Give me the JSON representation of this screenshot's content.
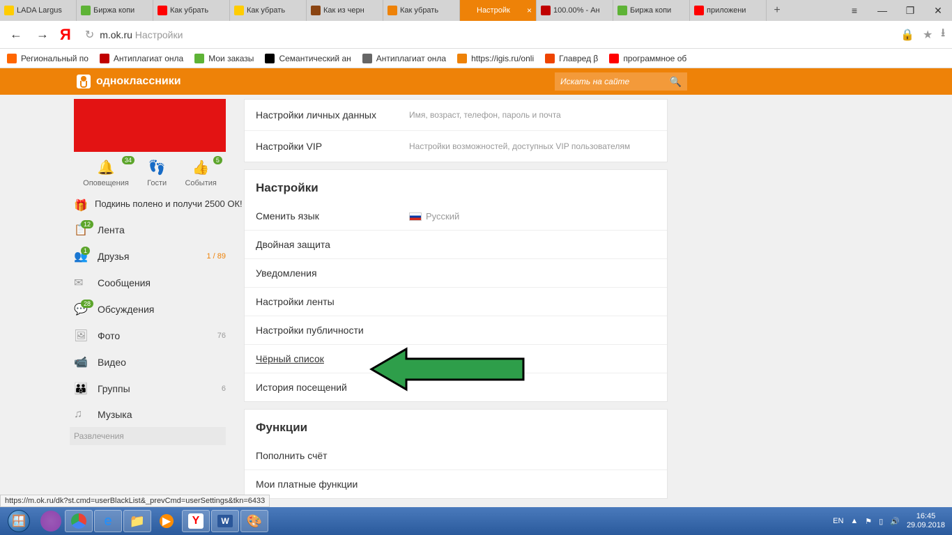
{
  "browser": {
    "tabs": [
      {
        "ico": "#ffcc00",
        "label": "LADA Largus"
      },
      {
        "ico": "#5eb336",
        "label": "Биржа копи"
      },
      {
        "ico": "#ff0000",
        "label": "Как убрать"
      },
      {
        "ico": "#ffcc00",
        "label": "Как убрать"
      },
      {
        "ico": "#8b4513",
        "label": "Как из черн"
      },
      {
        "ico": "#ee8208",
        "label": "Как убрать"
      },
      {
        "ico": "#ee8208",
        "label": "Настройк",
        "active": true
      },
      {
        "ico": "#c00000",
        "label": "100.00% - Ан"
      },
      {
        "ico": "#5eb336",
        "label": "Биржа копи"
      },
      {
        "ico": "#ff0000",
        "label": "приложени"
      }
    ],
    "url_prefix": "m.ok.ru",
    "url_rest": " Настройки",
    "bookmarks": [
      {
        "ico": "#ff6600",
        "label": "Региональный по"
      },
      {
        "ico": "#c00000",
        "label": "Антиплагиат онла"
      },
      {
        "ico": "#5eb336",
        "label": "Мои заказы"
      },
      {
        "ico": "#000000",
        "label": "Семантический ан"
      },
      {
        "ico": "#666666",
        "label": "Антиплагиат онла"
      },
      {
        "ico": "#ee8208",
        "label": "https://igis.ru/onli"
      },
      {
        "ico": "#ee4400",
        "label": "Главред β"
      },
      {
        "ico": "#ff0000",
        "label": "программное об"
      }
    ]
  },
  "ok": {
    "brand": "одноклассники",
    "search_placeholder": "Искать на сайте",
    "profile_actions": [
      {
        "icon": "🔔",
        "badge": "34",
        "label": "Оповещения"
      },
      {
        "icon": "👣",
        "badge": "",
        "label": "Гости"
      },
      {
        "icon": "👍",
        "badge": "5",
        "label": "События"
      }
    ],
    "promo": {
      "icon": "🎁",
      "text": "Подкинь полено и получи 2500 ОК!"
    },
    "sidebar": [
      {
        "icon": "📋",
        "badge": "12",
        "label": "Лента",
        "count": ""
      },
      {
        "icon": "👥",
        "badge": "1",
        "label": "Друзья",
        "count": "1 / 89",
        "orange": true
      },
      {
        "icon": "✉",
        "badge": "",
        "label": "Сообщения",
        "count": ""
      },
      {
        "icon": "💬",
        "badge": "28",
        "label": "Обсуждения",
        "count": ""
      },
      {
        "icon": "🖼",
        "badge": "",
        "label": "Фото",
        "count": "76"
      },
      {
        "icon": "📹",
        "badge": "",
        "label": "Видео",
        "count": ""
      },
      {
        "icon": "👪",
        "badge": "",
        "label": "Группы",
        "count": "6"
      },
      {
        "icon": "♫",
        "badge": "",
        "label": "Музыка",
        "count": ""
      }
    ],
    "sidebar_footer": "Развлечения",
    "top_rows": [
      {
        "title": "Настройки личных данных",
        "desc": "Имя, возраст, телефон, пароль и почта"
      },
      {
        "title": "Настройки VIP",
        "desc": "Настройки возможностей, доступных VIP пользователям"
      }
    ],
    "settings_header": "Настройки",
    "settings_rows": [
      {
        "label": "Сменить язык",
        "lang": "Русский"
      },
      {
        "label": "Двойная защита"
      },
      {
        "label": "Уведомления"
      },
      {
        "label": "Настройки ленты"
      },
      {
        "label": "Настройки публичности"
      },
      {
        "label": "Чёрный список",
        "underline": true
      },
      {
        "label": "История посещений"
      }
    ],
    "functions_header": "Функции",
    "functions_rows": [
      {
        "label": "Пополнить счёт"
      },
      {
        "label": "Мои платные функции"
      }
    ]
  },
  "status_url": "https://m.ok.ru/dk?st.cmd=userBlackList&_prevCmd=userSettings&tkn=6433",
  "taskbar": {
    "lang": "EN",
    "time": "16:45",
    "date": "29.09.2018"
  }
}
